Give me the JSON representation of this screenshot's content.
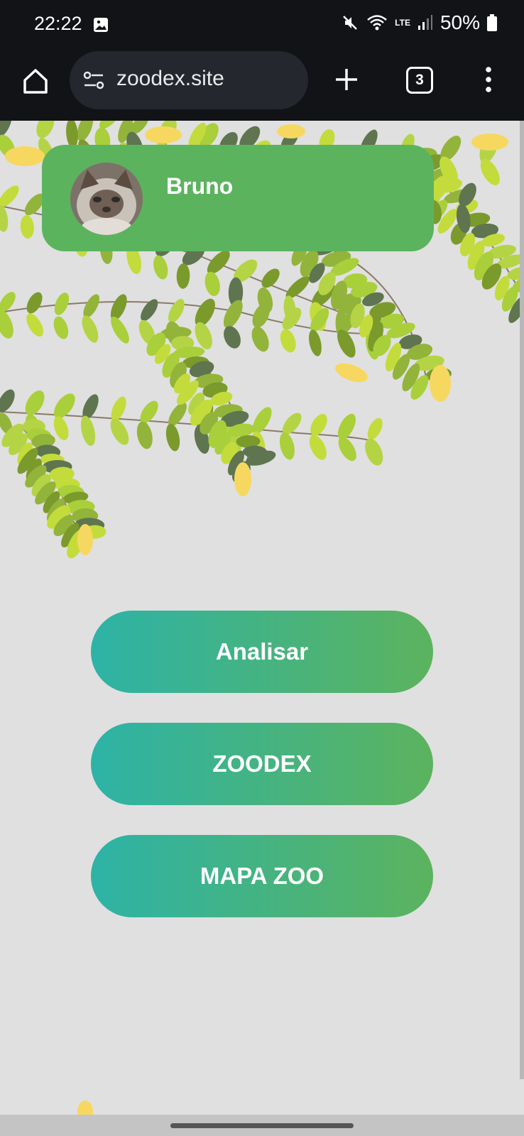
{
  "status_bar": {
    "time": "22:22",
    "battery": "50%",
    "network": "LTE"
  },
  "browser": {
    "url": "zoodex.site",
    "tab_count": "3"
  },
  "profile": {
    "name": "Bruno"
  },
  "menu": {
    "analisar_label": "Analisar",
    "zoodex_label": "ZOODEX",
    "mapa_label": "MAPA ZOO"
  },
  "colors": {
    "card": "#5cb35e",
    "button_start": "#2db3a6",
    "button_end": "#5cb35e",
    "background": "#e0e0e0"
  }
}
